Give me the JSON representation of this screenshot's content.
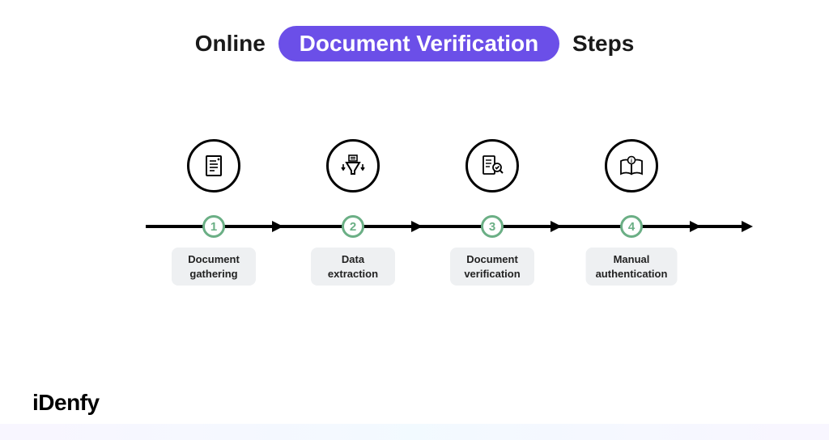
{
  "title": {
    "pre": "Online",
    "highlight": "Document Verification",
    "post": "Steps"
  },
  "steps": [
    {
      "num": "1",
      "icon": "document-icon",
      "label": "Document\ngathering"
    },
    {
      "num": "2",
      "icon": "funnel-icon",
      "label": "Data\nextraction"
    },
    {
      "num": "3",
      "icon": "doc-search-icon",
      "label": "Document\nverification"
    },
    {
      "num": "4",
      "icon": "book-info-icon",
      "label": "Manual\nauthentication"
    }
  ],
  "brand": "iDenfy"
}
